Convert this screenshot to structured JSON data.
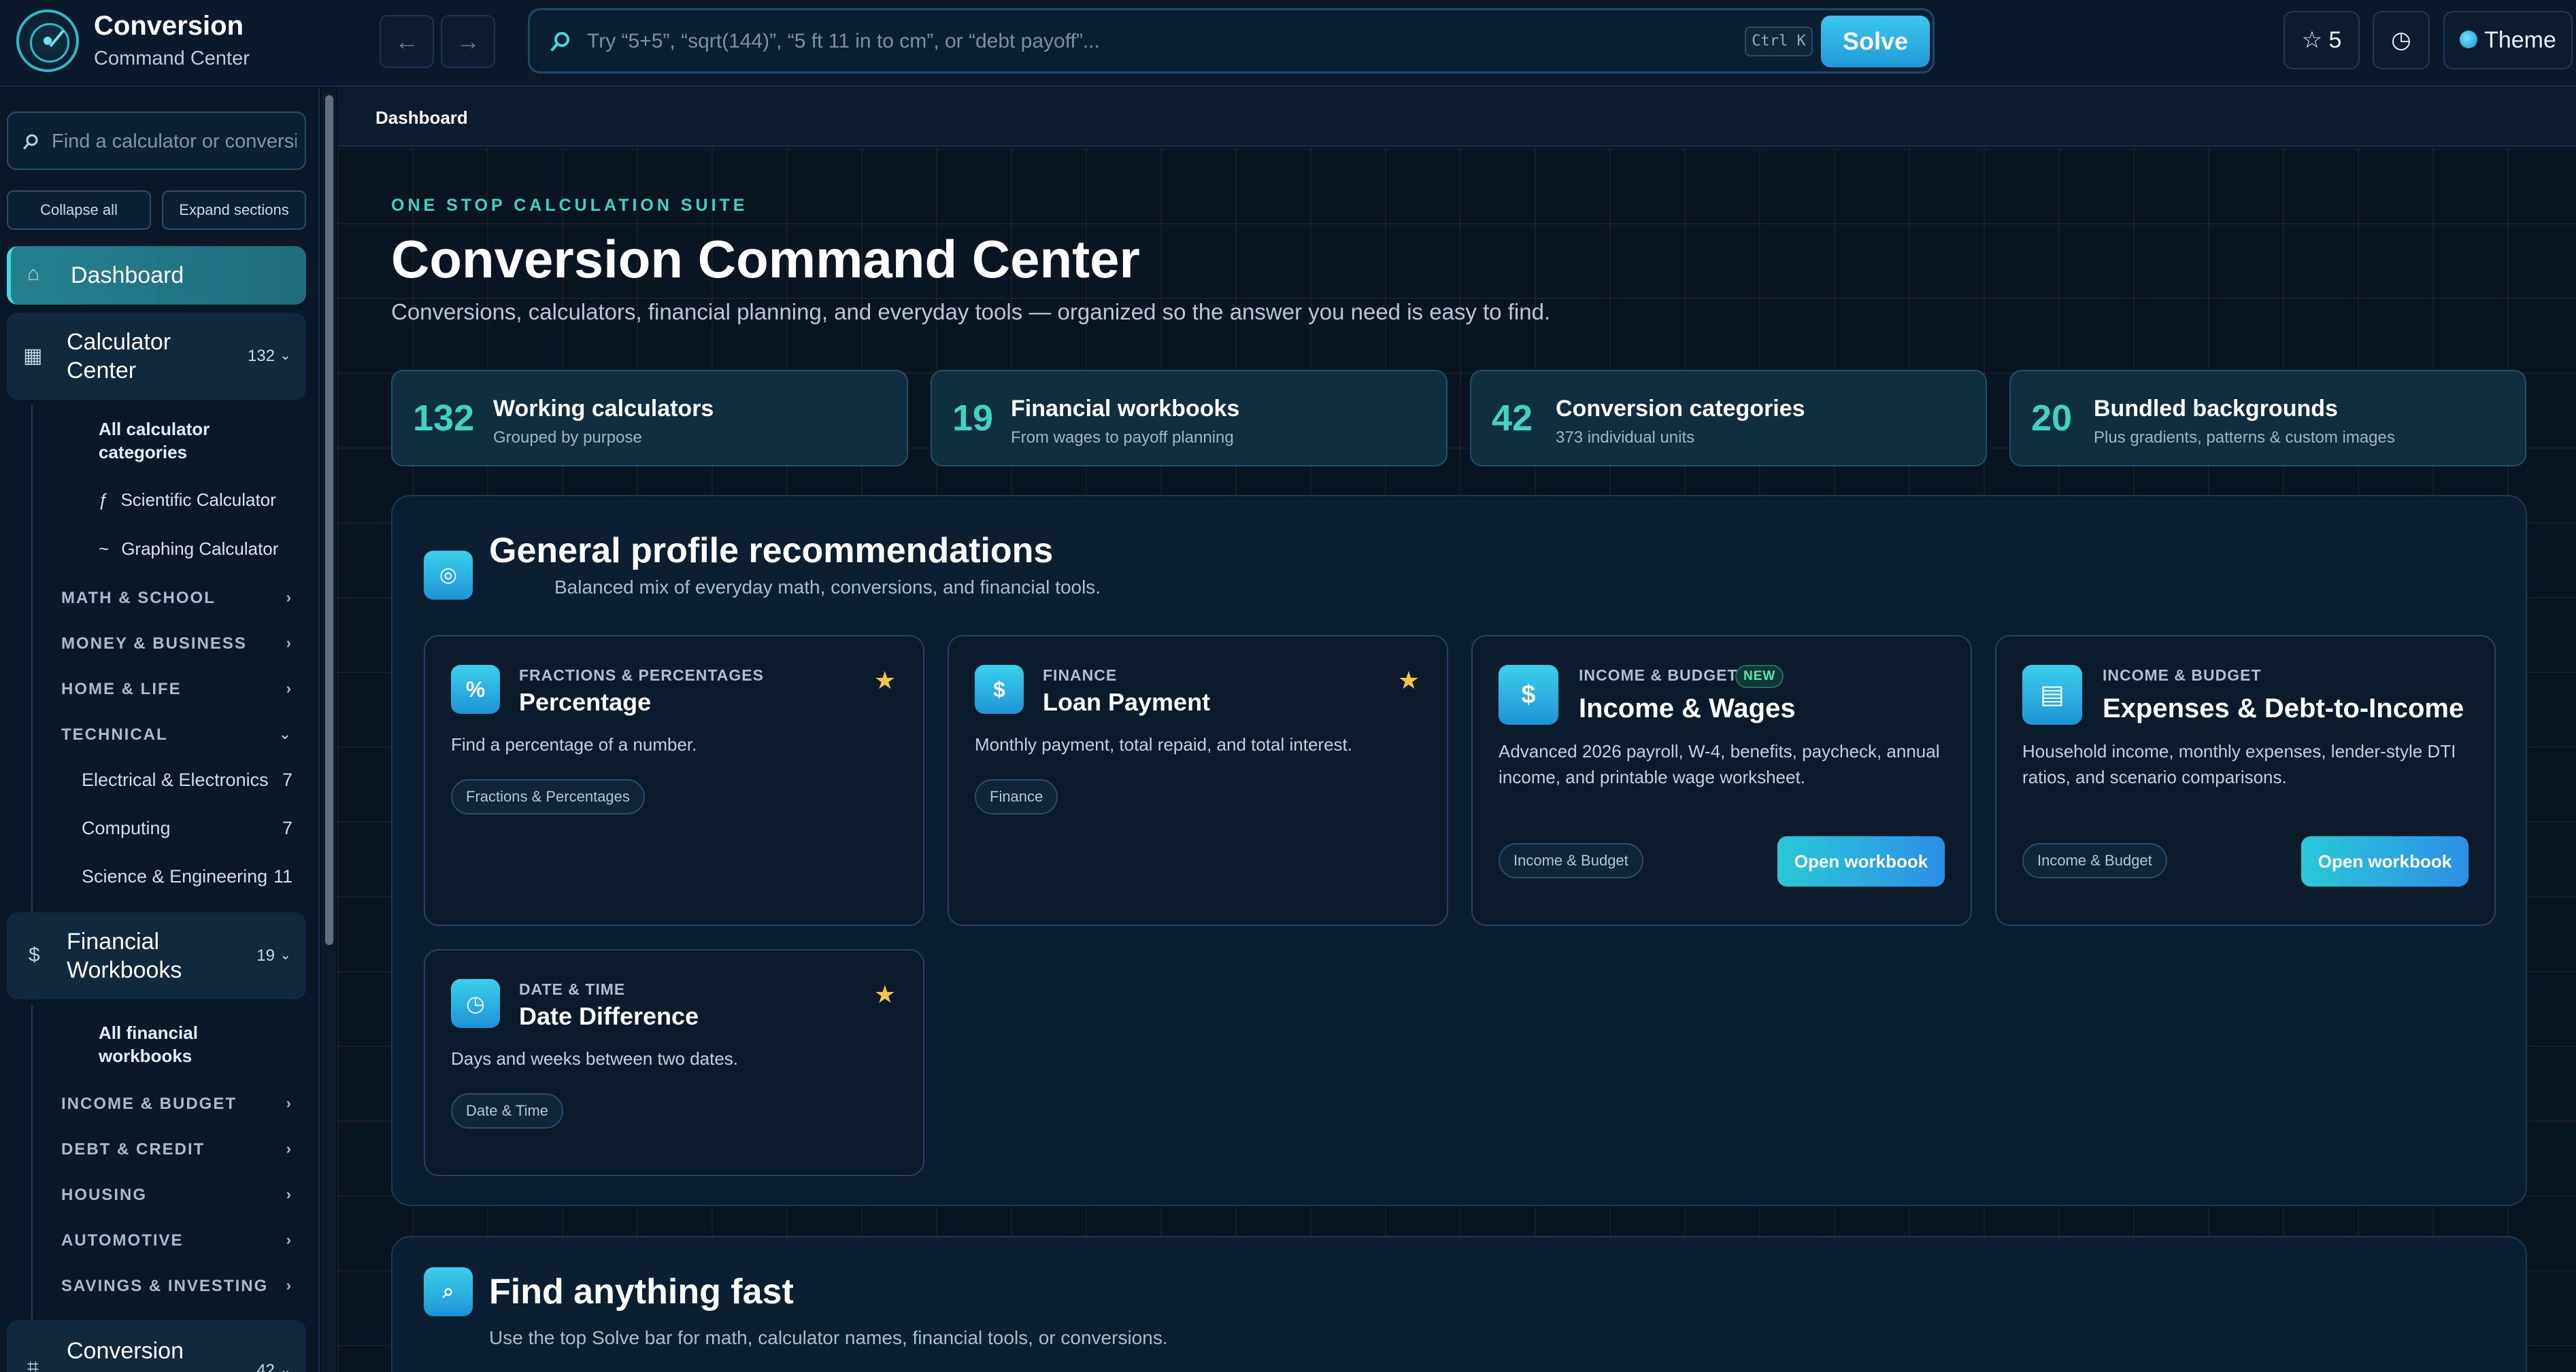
{
  "app": {
    "title": "Conversion",
    "subtitle": "Command Center"
  },
  "topbar": {
    "back_label": "←",
    "forward_label": "→",
    "solve_placeholder": "Try “5+5”, “sqrt(144)”, “5 ft 11 in to cm”, or “debt payoff”...",
    "shortcut": "Ctrl K",
    "solve_label": "Solve",
    "favorites_label": "☆ 5",
    "history_label": "◷",
    "theme_label": "Theme"
  },
  "sidebar": {
    "search_placeholder": "Find a calculator or conversion",
    "collapse_label": "Collapse all",
    "expand_label": "Expand sections",
    "dashboard": {
      "icon": "⌂",
      "label": "Dashboard"
    },
    "calculator_center": {
      "icon": "▦",
      "label_line1": "Calculator",
      "label_line2": "Center",
      "count": "132",
      "all_line1": "All calculator",
      "all_line2": "categories",
      "links": [
        {
          "icon": "ƒ",
          "label": "Scientific Calculator"
        },
        {
          "icon": "~",
          "label": "Graphing Calculator"
        }
      ],
      "sections": [
        "MATH & SCHOOL",
        "MONEY & BUSINESS",
        "HOME & LIFE",
        "TECHNICAL"
      ],
      "technical_items": [
        {
          "label": "Electrical & Electronics",
          "count": "7"
        },
        {
          "label": "Computing",
          "count": "7"
        },
        {
          "label": "Science & Engineering",
          "count": "11"
        }
      ]
    },
    "financial_workbooks": {
      "icon": "$",
      "label_line1": "Financial",
      "label_line2": "Workbooks",
      "count": "19",
      "all_line1": "All financial",
      "all_line2": "workbooks",
      "sections": [
        "INCOME & BUDGET",
        "DEBT & CREDIT",
        "HOUSING",
        "AUTOMOTIVE",
        "SAVINGS & INVESTING"
      ]
    },
    "conversion": {
      "icon": "⌗",
      "label": "Conversion",
      "count": "42"
    }
  },
  "breadcrumb": {
    "current": "Dashboard"
  },
  "hero": {
    "eyebrow": "ONE STOP CALCULATION SUITE",
    "title": "Conversion Command Center",
    "subtitle": "Conversions, calculators, financial planning, and everyday tools — organized so the answer you need is easy to find."
  },
  "stats": [
    {
      "value": "132",
      "title": "Working calculators",
      "sub": "Grouped by purpose"
    },
    {
      "value": "19",
      "title": "Financial workbooks",
      "sub": "From wages to payoff planning"
    },
    {
      "value": "42",
      "title": "Conversion categories",
      "sub": "373 individual units"
    },
    {
      "value": "20",
      "title": "Bundled backgrounds",
      "sub": "Plus gradients, patterns & custom images"
    }
  ],
  "recommendations": {
    "icon": "◎",
    "title": "General profile recommendations",
    "subtitle": "Balanced mix of everyday math, conversions, and financial tools.",
    "cards": [
      {
        "icon": "%",
        "category": "FRACTIONS & PERCENTAGES",
        "name": "Percentage",
        "desc": "Find a percentage of a number.",
        "tag": "Fractions & Percentages",
        "star": "★"
      },
      {
        "icon": "$",
        "category": "FINANCE",
        "name": "Loan Payment",
        "desc": "Monthly payment, total repaid, and total interest.",
        "tag": "Finance",
        "star": "★"
      },
      {
        "icon": "$",
        "category": "INCOME & BUDGET",
        "badge": "NEW",
        "name": "Income & Wages",
        "desc": "Advanced 2026 payroll, W-4, benefits, paycheck, annual income, and printable wage worksheet.",
        "tag": "Income & Budget",
        "action": "Open workbook"
      },
      {
        "icon": "▤",
        "category": "INCOME & BUDGET",
        "name": "Expenses & Debt-to-Income",
        "desc": "Household income, monthly expenses, lender-style DTI ratios, and scenario comparisons.",
        "tag": "Income & Budget",
        "action": "Open workbook"
      },
      {
        "icon": "◷",
        "category": "DATE & TIME",
        "name": "Date Difference",
        "desc": "Days and weeks between two dates.",
        "tag": "Date & Time",
        "star": "★"
      }
    ]
  },
  "find_fast": {
    "icon": "⌕",
    "title": "Find anything fast",
    "subtitle": "Use the top Solve bar for math, calculator names, financial tools, or conversions."
  },
  "colors": {
    "accent": "#3fd3c5",
    "primary_button": "#2b9fe0",
    "star": "#f4c442",
    "background": "#08121f"
  }
}
